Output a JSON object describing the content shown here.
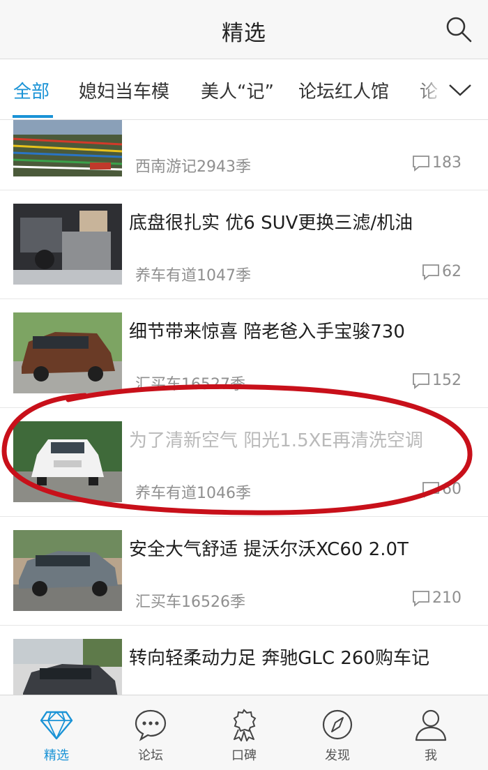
{
  "header": {
    "title": "精选"
  },
  "tabs": [
    {
      "label": "全部",
      "active": true
    },
    {
      "label": "媳妇当车模"
    },
    {
      "label": "美人“记”"
    },
    {
      "label": "论坛红人馆"
    },
    {
      "label": "论"
    }
  ],
  "feed": [
    {
      "title": "",
      "source": "西南游记2943季",
      "comments": "183",
      "read": false
    },
    {
      "title": "底盘很扎实 优6 SUV更换三滤/机油",
      "source": "养车有道1047季",
      "comments": "62",
      "read": false
    },
    {
      "title": "细节带来惊喜 陪老爸入手宝骏730",
      "source": "汇买车16527季",
      "comments": "152",
      "read": false
    },
    {
      "title": "为了清新空气 阳光1.5XE再清洗空调",
      "source": "养车有道1046季",
      "comments": "60",
      "read": true
    },
    {
      "title": "安全大气舒适 提沃尔沃XC60 2.0T",
      "source": "汇买车16526季",
      "comments": "210",
      "read": false
    },
    {
      "title": "转向轻柔动力足 奔驰GLC 260购车记",
      "source": "",
      "comments": "",
      "read": false
    }
  ],
  "bottom_nav": [
    {
      "label": "精选",
      "icon": "diamond-icon",
      "active": true
    },
    {
      "label": "论坛",
      "icon": "chat-bubble-icon"
    },
    {
      "label": "口碑",
      "icon": "rosette-icon"
    },
    {
      "label": "发现",
      "icon": "compass-icon"
    },
    {
      "label": "我",
      "icon": "person-icon"
    }
  ],
  "colors": {
    "accent": "#1a93d6",
    "annotation": "#c8101a",
    "read_title": "#b9b9b9"
  }
}
